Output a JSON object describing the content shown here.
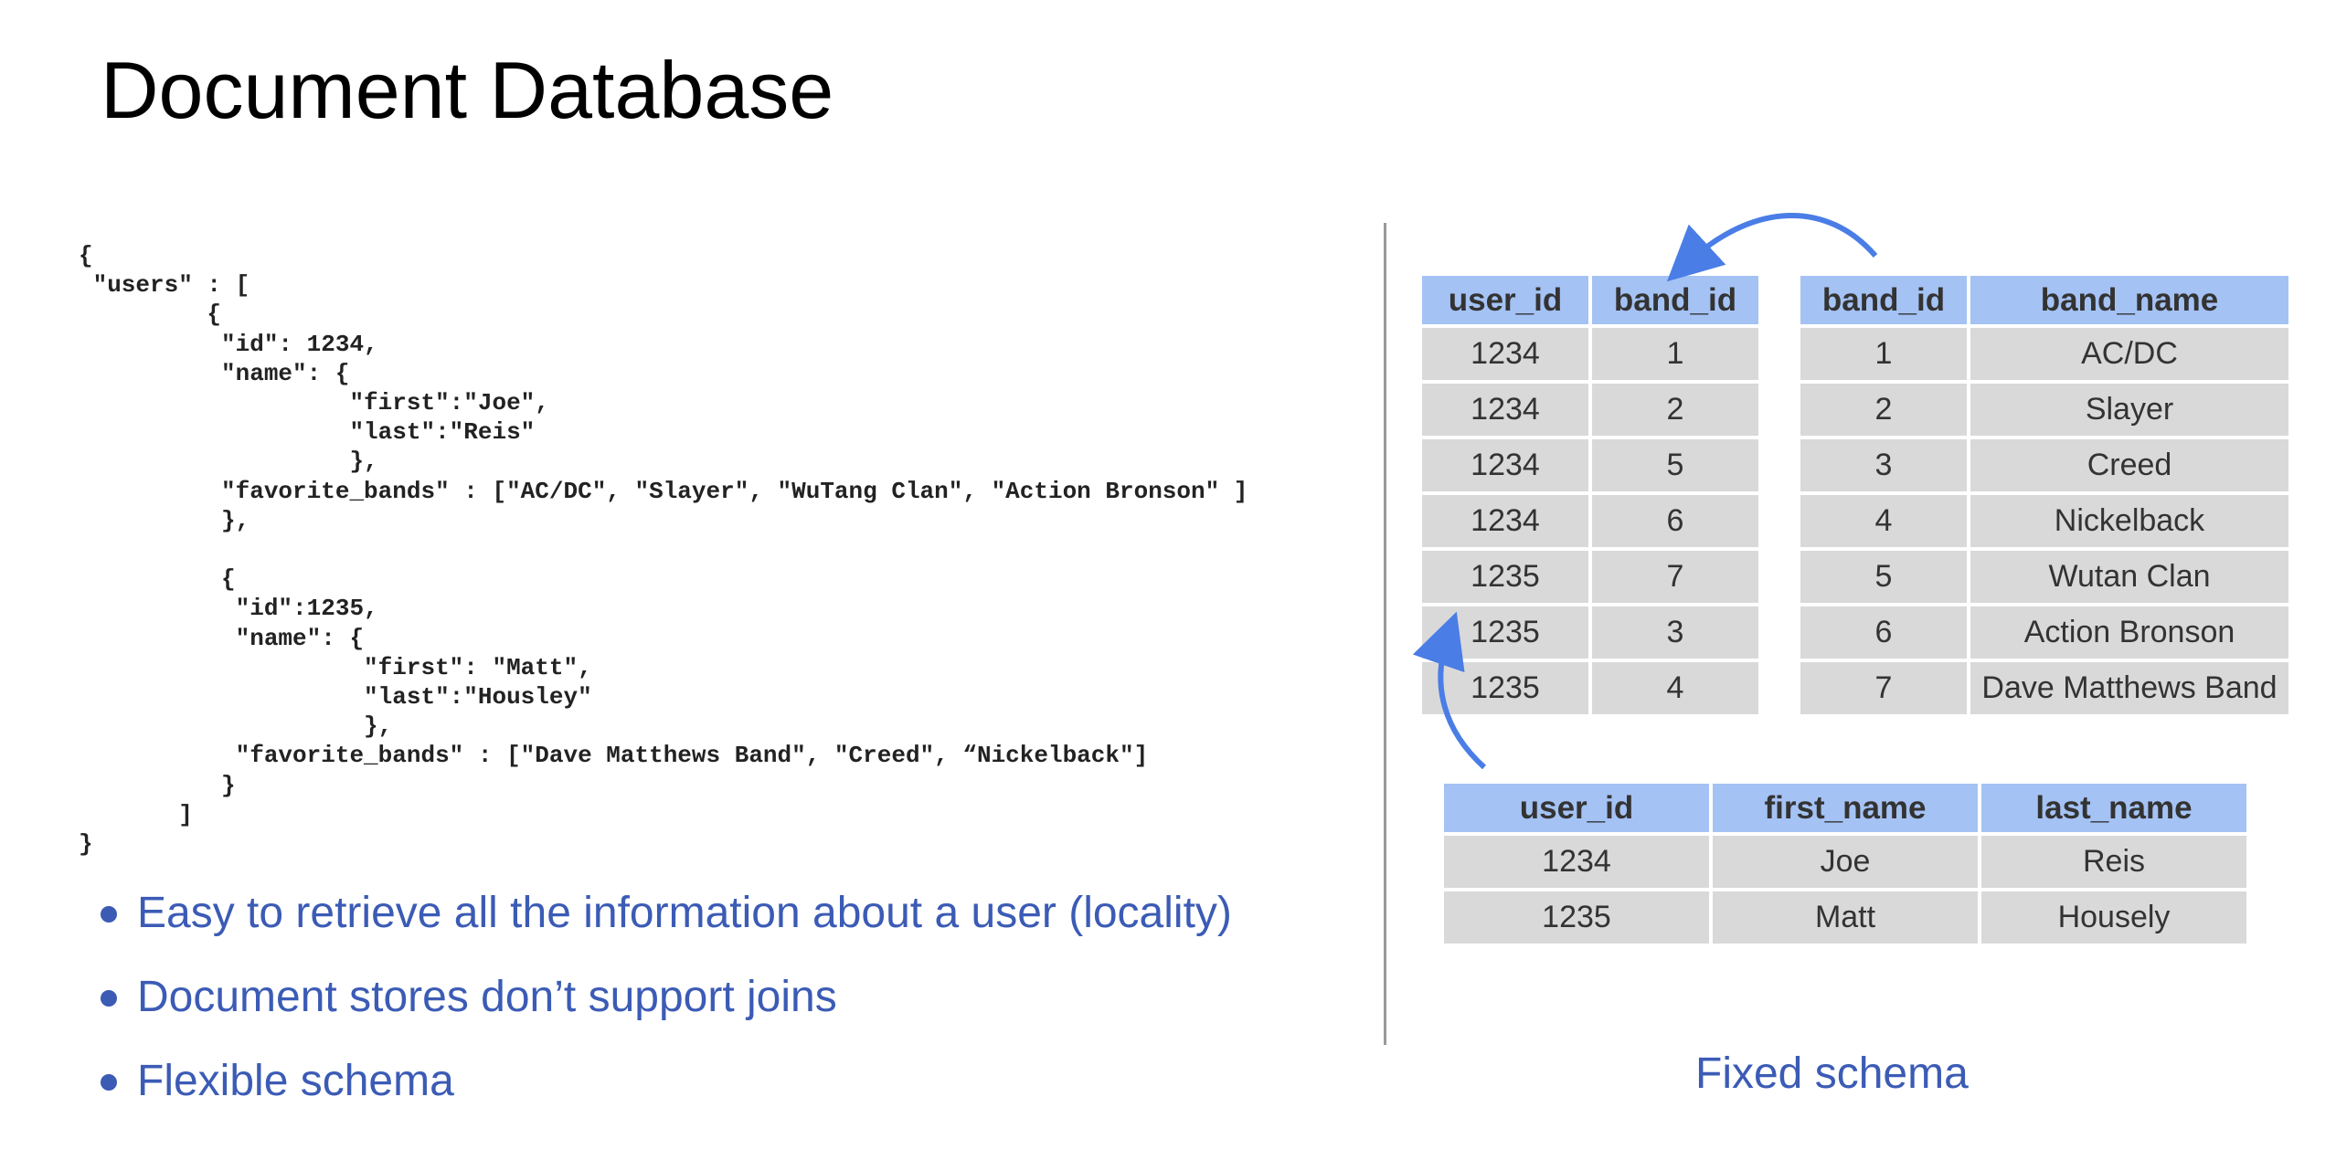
{
  "slide": {
    "title": "Document Database",
    "json_code": "{\n \"users\" : [\n         {\n          \"id\": 1234,\n          \"name\": {\n                   \"first\":\"Joe\",\n                   \"last\":\"Reis\"\n                   },\n          \"favorite_bands\" : [\"AC/DC\", \"Slayer\", \"WuTang Clan\", \"Action Bronson\" ]\n          },\n\n          {\n           \"id\":1235,\n           \"name\": {\n                    \"first\": \"Matt\",\n                    \"last\":\"Housley\"\n                    },\n           \"favorite_bands\" : [\"Dave Matthews Band\", \"Creed\", “Nickelback\"]\n          }\n       ]\n}",
    "bullets": [
      "Easy to retrieve all the information about a user (locality)",
      "Document stores don’t support joins",
      "Flexible schema"
    ],
    "fixed_schema_label": "Fixed schema"
  },
  "tables": {
    "user_bands": {
      "headers": [
        "user_id",
        "band_id"
      ],
      "rows": [
        [
          "1234",
          "1"
        ],
        [
          "1234",
          "2"
        ],
        [
          "1234",
          "5"
        ],
        [
          "1234",
          "6"
        ],
        [
          "1235",
          "7"
        ],
        [
          "1235",
          "3"
        ],
        [
          "1235",
          "4"
        ]
      ]
    },
    "bands": {
      "headers": [
        "band_id",
        "band_name"
      ],
      "rows": [
        [
          "1",
          "AC/DC"
        ],
        [
          "2",
          "Slayer"
        ],
        [
          "3",
          "Creed"
        ],
        [
          "4",
          "Nickelback"
        ],
        [
          "5",
          "Wutan Clan"
        ],
        [
          "6",
          "Action Bronson"
        ],
        [
          "7",
          "Dave Matthews Band"
        ]
      ]
    },
    "users": {
      "headers": [
        "user_id",
        "first_name",
        "last_name"
      ],
      "rows": [
        [
          "1234",
          "Joe",
          "Reis"
        ],
        [
          "1235",
          "Matt",
          "Housely"
        ]
      ]
    }
  },
  "colors": {
    "header_fill": "#a4c2f4",
    "cell_fill": "#d9d9d9",
    "accent_blue": "#3b5bb5",
    "arrow_blue": "#4a7de6"
  },
  "icons": [
    "arrow-bands-to-user-bands-icon",
    "arrow-users-to-user-bands-icon",
    "bullet-dot-icon"
  ]
}
